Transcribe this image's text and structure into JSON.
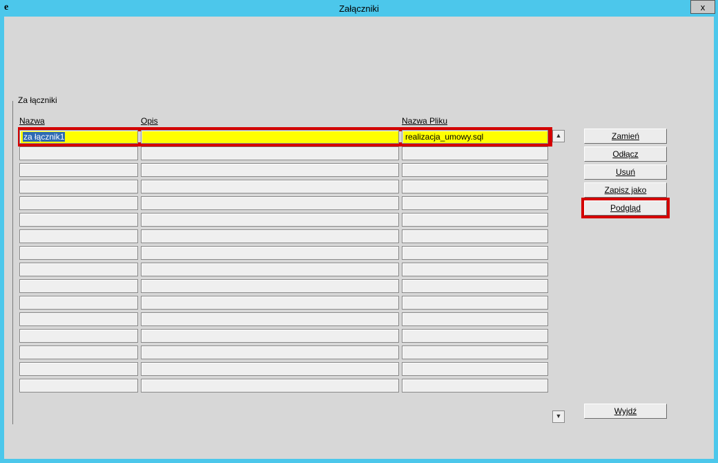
{
  "window": {
    "title": "Załączniki",
    "close_label": "x",
    "icon_text": "e"
  },
  "group": {
    "label": "Za łączniki"
  },
  "columns": {
    "nazwa": "Nazwa",
    "opis": "Opis",
    "nazwa_pliku": "Nazwa Pliku"
  },
  "rows": [
    {
      "nazwa": "za łącznik1",
      "opis": "",
      "nazwa_pliku": "realizacja_umowy.sql",
      "selected": true
    }
  ],
  "empty_row_count": 15,
  "buttons": {
    "zamien": "Zamień",
    "odlacz": "Odłącz",
    "usun": "Usuń",
    "zapisz_jako": "Zapisz jako",
    "podglad": "Podgląd",
    "wyjdz": "Wyjdź"
  },
  "scrollbar": {
    "up": "▲",
    "down": "▼"
  }
}
